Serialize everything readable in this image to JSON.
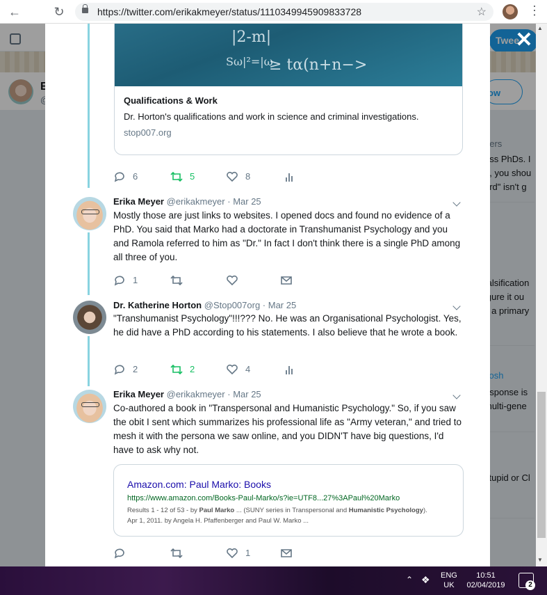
{
  "browser": {
    "url": "https://twitter.com/erikakmeyer/status/1110349945909833728"
  },
  "background": {
    "tweet_button": "Twee",
    "profile_letter": "E",
    "profile_handle": "@",
    "follow_button": "ow",
    "sidebar_lines": [
      "hers",
      "ess PhDs. I",
      "e, you shou",
      "ord\" isn't g",
      "falsification",
      "igure it ou",
      "s a primary",
      "Josh",
      "esponse is",
      "multi-gene",
      "stupid or Cl"
    ]
  },
  "card": {
    "title": "Qualifications & Work",
    "description": "Dr. Horton's qualifications and work in science and criminal investigations.",
    "domain": "stop007.org",
    "image_chalk": [
      "|2-m|",
      "≥ tα(n+n−>",
      "Sω|²=|ω"
    ]
  },
  "first_actions": {
    "replies": "6",
    "retweets": "5",
    "likes": "8"
  },
  "tweets": [
    {
      "name": "Erika Meyer",
      "handle": "@erikakmeyer",
      "date": "· Mar 25",
      "text": "Mostly those are just links to websites. I opened docs and found no evidence of a PhD. You said that Marko had a doctorate in Transhumanist Psychology and you and Ramola referred to him as \"Dr.\" In fact I don't think there is a single PhD among all three of you.",
      "replies": "1",
      "retweets": "",
      "likes": ""
    },
    {
      "name": "Dr. Katherine Horton",
      "handle": "@Stop007org",
      "date": "· Mar 25",
      "text": "\"Transhumanist Psychology\"!!!??? No. He was an Organisational Psychologist. Yes, he did have a PhD according to his statements. I also believe that he wrote a book.",
      "replies": "2",
      "retweets": "2",
      "likes": "4"
    },
    {
      "name": "Erika Meyer",
      "handle": "@erikakmeyer",
      "date": "· Mar 25",
      "text": "Co-authored a book in \"Transpersonal and Humanistic Psychology.\" So, if you saw the obit I sent which summarizes his professional life as \"Army veteran,\" and tried to mesh it with the persona we saw online, and you DIDN'T have big questions, I'd have to ask why not.",
      "replies": "",
      "retweets": "",
      "likes": "1"
    }
  ],
  "link_card": {
    "title": "Amazon.com: Paul Marko: Books",
    "url": "https://www.amazon.com/Books-Paul-Marko/s?ie=UTF8...27%3APaul%20Marko",
    "snippet_1_plain": "Results 1 - 12 of 53 - by ",
    "snippet_1_bold": "Paul Marko",
    "snippet_1_rest": " ... (SUNY series in Transpersonal and ",
    "snippet_1_bold2": "Humanistic Psychology",
    "snippet_1_end": ").",
    "snippet_2": "Apr 1, 2011. by Angela H. Pfaffenberger and Paul W. Marko ..."
  },
  "taskbar": {
    "lang_top": "ENG",
    "lang_bottom": "UK",
    "time": "10:51",
    "date": "02/04/2019",
    "notification_count": "2"
  },
  "colors": {
    "thread_line": "#88d3e0",
    "retweet_active": "#17bf63",
    "twitter_blue": "#1da1f2"
  }
}
